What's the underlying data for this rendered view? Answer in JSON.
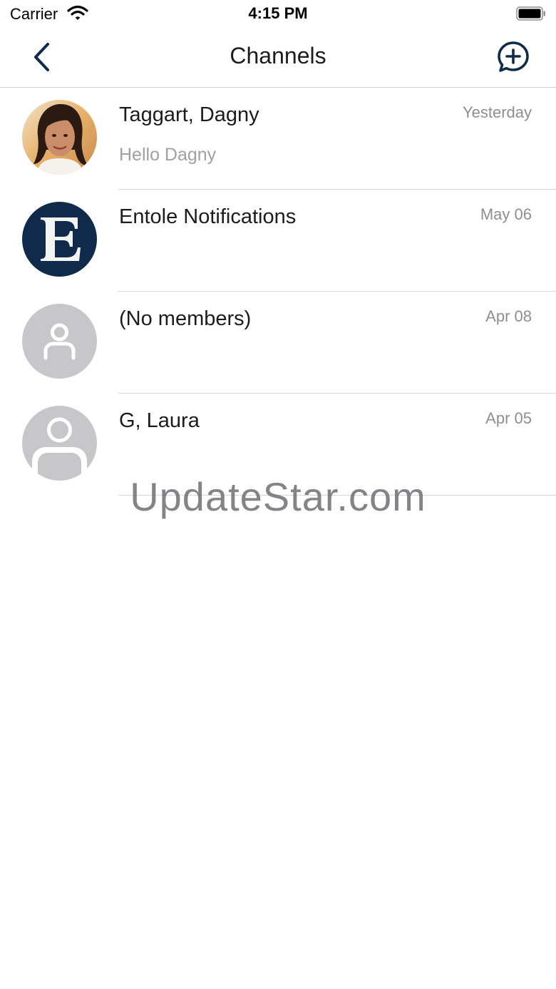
{
  "status_bar": {
    "carrier": "Carrier",
    "time": "4:15 PM",
    "wifi_icon": "wifi-icon",
    "battery_icon": "battery-icon"
  },
  "nav": {
    "title": "Channels",
    "back_icon": "chevron-left-icon",
    "new_icon": "chat-bubble-plus-icon",
    "accent_color": "#0f2a4a"
  },
  "channels": [
    {
      "name": "Taggart, Dagny",
      "date": "Yesterday",
      "preview": "Hello Dagny",
      "avatar": "photo"
    },
    {
      "name": "Entole Notifications",
      "date": "May 06",
      "preview": "",
      "avatar": "letter-e-logo"
    },
    {
      "name": "(No members)",
      "date": "Apr 08",
      "preview": "",
      "avatar": "person-placeholder-small"
    },
    {
      "name": "G, Laura",
      "date": "Apr 05",
      "preview": "",
      "avatar": "person-placeholder"
    }
  ],
  "watermark": "UpdateStar.com"
}
